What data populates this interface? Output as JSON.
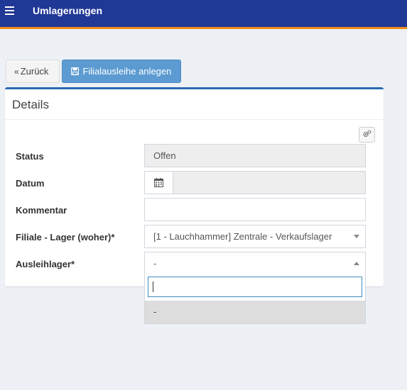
{
  "header": {
    "title": "Umlagerungen",
    "menu_icon": "hamburger-menu-icon"
  },
  "toolbar": {
    "back_label": "Zurück",
    "back_icon": "«",
    "create_label": "Filialausleihe anlegen",
    "create_icon": "save-icon"
  },
  "panel": {
    "title": "Details",
    "settings_icon": "cogs-icon"
  },
  "form": {
    "status": {
      "label": "Status",
      "value": "Offen"
    },
    "datum": {
      "label": "Datum",
      "icon": "calendar-icon",
      "value": ""
    },
    "kommentar": {
      "label": "Kommentar",
      "value": ""
    },
    "filiale": {
      "label": "Filiale - Lager (woher)*",
      "value": "[1 - Lauchhammer] Zentrale - Verkaufslager"
    },
    "ausleihlager": {
      "label": "Ausleihlager*",
      "value": "-"
    }
  },
  "dropdown": {
    "search_value": "",
    "options": [
      "-"
    ]
  },
  "colors": {
    "header_bg": "#203896",
    "header_accent": "#f08a1c",
    "primary_button": "#5b9bd1",
    "panel_border": "#2969b0"
  }
}
